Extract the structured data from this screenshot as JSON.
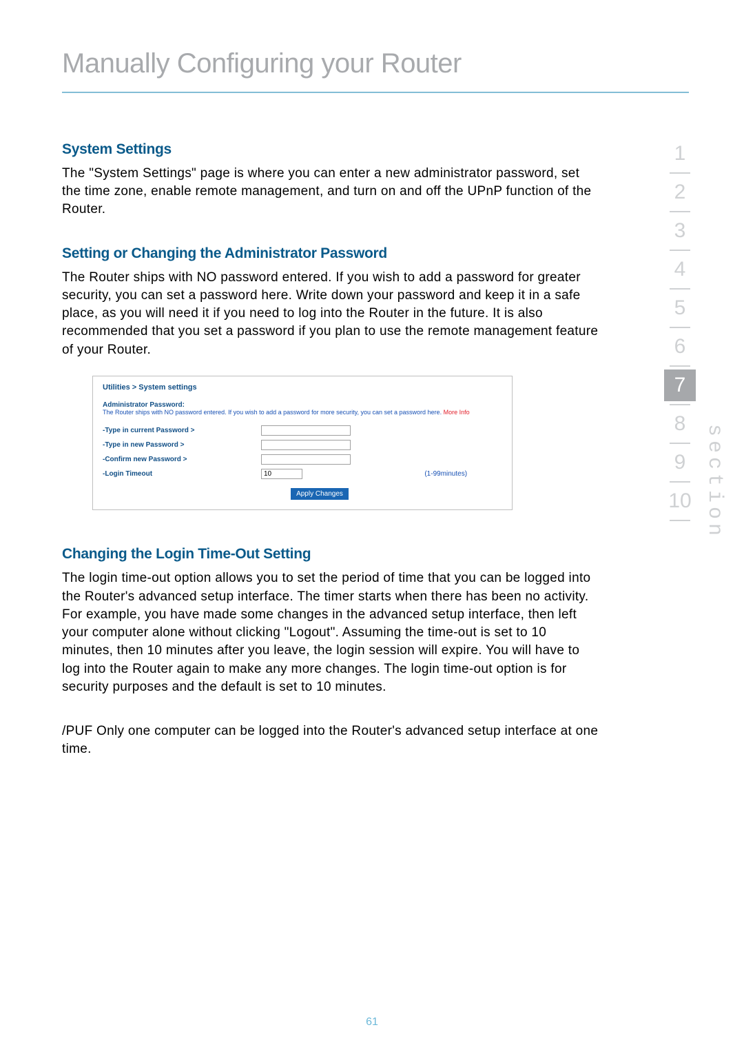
{
  "page": {
    "title": "Manually Configuring your Router",
    "number": "61"
  },
  "sections": {
    "s1": {
      "heading": "System Settings",
      "body": "The \"System Settings\" page is where you can enter a new administrator password, set the time zone, enable remote management, and turn on and off the UPnP function of the Router."
    },
    "s2": {
      "heading": "Setting or Changing the Administrator Password",
      "body": "The Router ships with NO password entered. If you wish to add a password for greater security, you can set a password here. Write down your password and keep it in a safe place, as you will need it if you need to log into the Router in the future. It is also recommended that you set a password if you plan to use the remote management feature of your Router."
    },
    "s3": {
      "heading": "Changing the Login Time-Out Setting",
      "body": "The login time-out option allows you to set the period of time that you can be logged into the Router's advanced setup interface. The timer starts when there has been no activity. For example, you have made some changes in the advanced setup interface, then left your computer alone without clicking \"Logout\". Assuming the time-out is set to 10 minutes, then 10 minutes after you leave, the login session will expire. You will have to log into the Router again to make any more changes. The login time-out option is for security purposes and the default is set to 10 minutes."
    },
    "note": "/PUF Only one computer can be logged into the Router's advanced setup interface at one time."
  },
  "embedded_ui": {
    "breadcrumb": "Utilities > System settings",
    "admin_label": "Administrator Password:",
    "admin_desc": "The Router ships with NO password entered. If you wish to add a password for more security, you can set a password here. ",
    "more": "More Info",
    "field_current": "-Type in current Password >",
    "field_new": "-Type in new Password >",
    "field_confirm": "-Confirm new Password >",
    "field_timeout": "-Login Timeout",
    "timeout_value": "10",
    "timeout_range": "(1-99minutes)",
    "apply_btn": "Apply Changes"
  },
  "sidenav": {
    "label": "section",
    "items": [
      "1",
      "2",
      "3",
      "4",
      "5",
      "6",
      "7",
      "8",
      "9",
      "10"
    ],
    "active_index": 6
  }
}
